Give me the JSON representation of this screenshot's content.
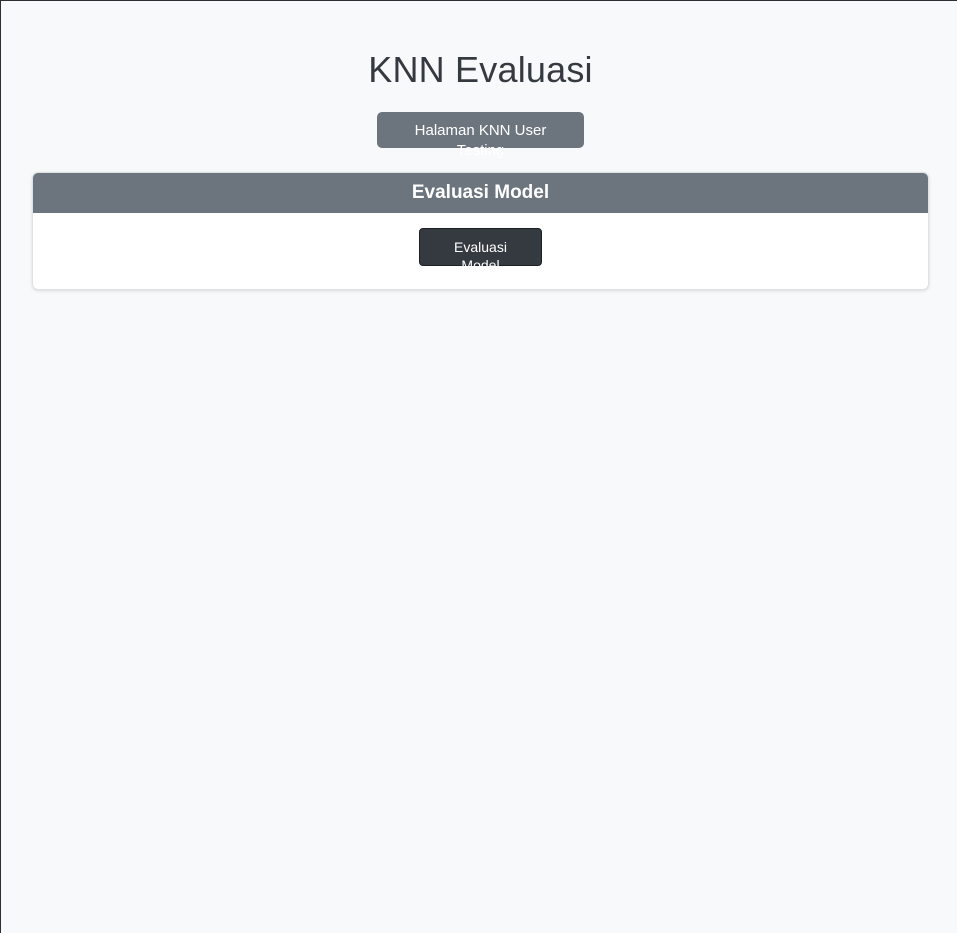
{
  "page": {
    "title": "KNN Evaluasi"
  },
  "nav": {
    "user_testing_link": "Halaman KNN User Testing"
  },
  "card": {
    "header": "Evaluasi Model",
    "button_label": "Evaluasi Model"
  },
  "colors": {
    "background": "#f8f9fa",
    "secondary": "#6c757d",
    "dark": "#343a40"
  }
}
